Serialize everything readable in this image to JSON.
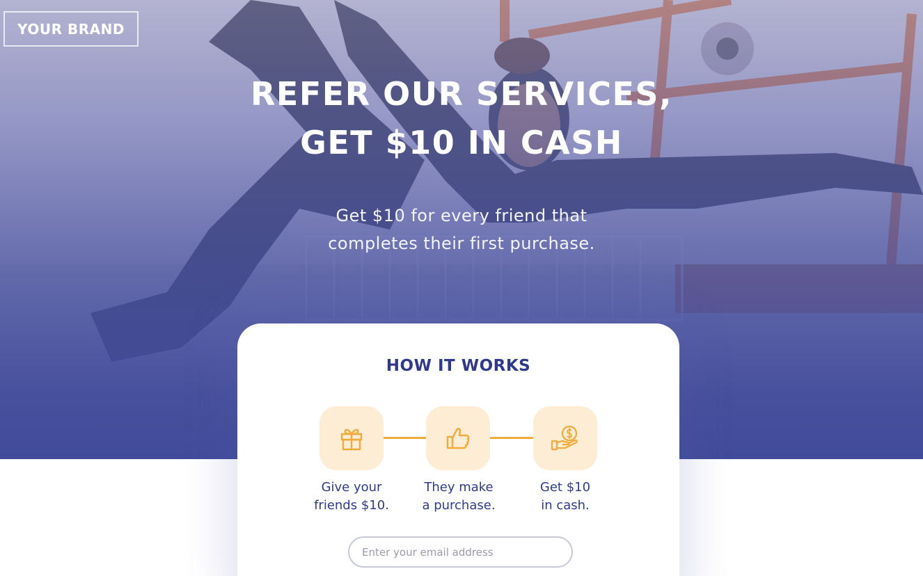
{
  "brand": {
    "label": "YOUR BRAND"
  },
  "hero": {
    "headline_line1": "REFER OUR SERVICES,",
    "headline_line2": "GET $10 IN CASH",
    "sub_line1": "Get $10 for every friend that",
    "sub_line2": "completes their first purchase."
  },
  "how_it_works": {
    "title": "HOW IT WORKS",
    "steps": [
      {
        "icon": "gift-icon",
        "line1": "Give your",
        "line2": "friends $10."
      },
      {
        "icon": "thumbs-up-icon",
        "line1": "They make",
        "line2": "a purchase."
      },
      {
        "icon": "hand-coin-icon",
        "line1": "Get $10",
        "line2": "in cash."
      }
    ]
  },
  "email": {
    "placeholder": "Enter your email address",
    "value": ""
  },
  "colors": {
    "brand_blue": "#2f3a8f",
    "hero_overlay": "#424c9a",
    "accent_orange": "#f0ab3a",
    "icon_tile": "#fdedd5"
  }
}
